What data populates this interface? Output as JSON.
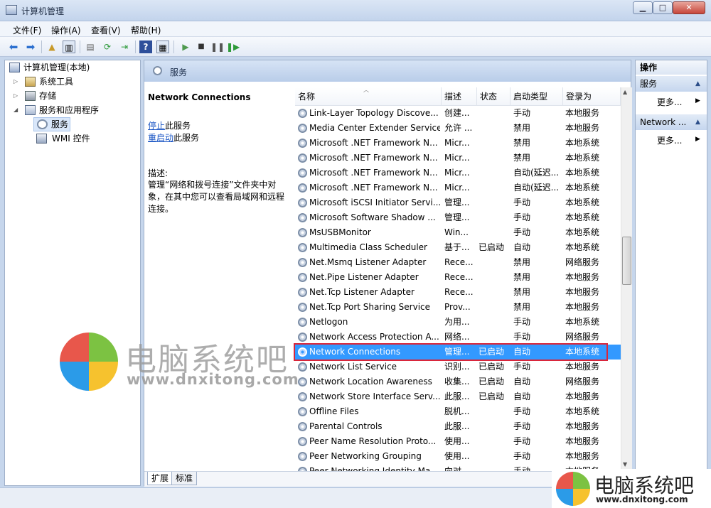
{
  "window": {
    "title": "计算机管理",
    "min": "▁",
    "max": "□",
    "close": "✕"
  },
  "menu": [
    "文件(F)",
    "操作(A)",
    "查看(V)",
    "帮助(H)"
  ],
  "tree": {
    "root": "计算机管理(本地)",
    "items": [
      "系统工具",
      "存储",
      "服务和应用程序",
      "服务",
      "WMI 控件"
    ]
  },
  "center": {
    "heading": "服务",
    "selected_title": "Network Connections",
    "stop_link": "停止",
    "stop_suffix": "此服务",
    "restart_link": "重启动",
    "restart_suffix": "此服务",
    "desc_label": "描述:",
    "desc_text": "管理“网络和拨号连接”文件夹中对象，在其中您可以查看局域网和远程连接。",
    "tabs": [
      "扩展",
      "标准"
    ]
  },
  "grid": {
    "columns": [
      "名称",
      "描述",
      "状态",
      "启动类型",
      "登录为"
    ],
    "rows": [
      {
        "name": "Link-Layer Topology Discove...",
        "desc": "创建...",
        "status": "",
        "startup": "手动",
        "logon": "本地服务"
      },
      {
        "name": "Media Center Extender Service",
        "desc": "允许 ...",
        "status": "",
        "startup": "禁用",
        "logon": "本地服务"
      },
      {
        "name": "Microsoft .NET Framework N...",
        "desc": "Micr...",
        "status": "",
        "startup": "禁用",
        "logon": "本地系统"
      },
      {
        "name": "Microsoft .NET Framework N...",
        "desc": "Micr...",
        "status": "",
        "startup": "禁用",
        "logon": "本地系统"
      },
      {
        "name": "Microsoft .NET Framework N...",
        "desc": "Micr...",
        "status": "",
        "startup": "自动(延迟...",
        "logon": "本地系统"
      },
      {
        "name": "Microsoft .NET Framework N...",
        "desc": "Micr...",
        "status": "",
        "startup": "自动(延迟...",
        "logon": "本地系统"
      },
      {
        "name": "Microsoft iSCSI Initiator Servi...",
        "desc": "管理...",
        "status": "",
        "startup": "手动",
        "logon": "本地系统"
      },
      {
        "name": "Microsoft Software Shadow ...",
        "desc": "管理...",
        "status": "",
        "startup": "手动",
        "logon": "本地系统"
      },
      {
        "name": "MsUSBMonitor",
        "desc": "Win...",
        "status": "",
        "startup": "手动",
        "logon": "本地系统"
      },
      {
        "name": "Multimedia Class Scheduler",
        "desc": "基于...",
        "status": "已启动",
        "startup": "自动",
        "logon": "本地系统"
      },
      {
        "name": "Net.Msmq Listener Adapter",
        "desc": "Rece...",
        "status": "",
        "startup": "禁用",
        "logon": "网络服务"
      },
      {
        "name": "Net.Pipe Listener Adapter",
        "desc": "Rece...",
        "status": "",
        "startup": "禁用",
        "logon": "本地服务"
      },
      {
        "name": "Net.Tcp Listener Adapter",
        "desc": "Rece...",
        "status": "",
        "startup": "禁用",
        "logon": "本地服务"
      },
      {
        "name": "Net.Tcp Port Sharing Service",
        "desc": "Prov...",
        "status": "",
        "startup": "禁用",
        "logon": "本地服务"
      },
      {
        "name": "Netlogon",
        "desc": "为用...",
        "status": "",
        "startup": "手动",
        "logon": "本地系统"
      },
      {
        "name": "Network Access Protection A...",
        "desc": "网络...",
        "status": "",
        "startup": "手动",
        "logon": "网络服务"
      },
      {
        "name": "Network Connections",
        "desc": "管理...",
        "status": "已启动",
        "startup": "自动",
        "logon": "本地系统",
        "selected": true
      },
      {
        "name": "Network List Service",
        "desc": "识别...",
        "status": "已启动",
        "startup": "手动",
        "logon": "本地服务"
      },
      {
        "name": "Network Location Awareness",
        "desc": "收集...",
        "status": "已启动",
        "startup": "自动",
        "logon": "网络服务"
      },
      {
        "name": "Network Store Interface Serv...",
        "desc": "此服...",
        "status": "已启动",
        "startup": "自动",
        "logon": "本地服务"
      },
      {
        "name": "Offline Files",
        "desc": "脱机...",
        "status": "",
        "startup": "手动",
        "logon": "本地系统"
      },
      {
        "name": "Parental Controls",
        "desc": "此服...",
        "status": "",
        "startup": "手动",
        "logon": "本地服务"
      },
      {
        "name": "Peer Name Resolution Proto...",
        "desc": "使用...",
        "status": "",
        "startup": "手动",
        "logon": "本地服务"
      },
      {
        "name": "Peer Networking Grouping",
        "desc": "使用...",
        "status": "",
        "startup": "手动",
        "logon": "本地服务"
      },
      {
        "name": "Peer Networking Identity Ma...",
        "desc": "向对...",
        "status": "",
        "startup": "手动",
        "logon": "本地服务"
      }
    ]
  },
  "actions": {
    "header": "操作",
    "section1": "服务",
    "more1": "更多...",
    "section2": "Network ...",
    "more2": "更多..."
  },
  "watermark": {
    "text": "电脑系统吧",
    "url": "www.dnxitong.com"
  },
  "colors": {
    "selection": "#3399ff",
    "highlight_box": "#d9263b"
  }
}
